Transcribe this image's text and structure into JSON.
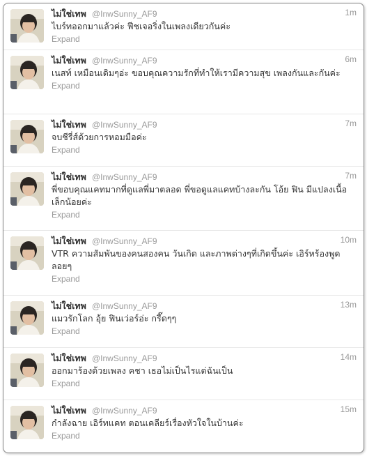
{
  "tweets": [
    {
      "name": "ไม่ใช่เทพ",
      "handle": "@InwSunny_AF9",
      "time": "1m",
      "text": "ไบร์ทออกมาแล้วค่ะ ฟีชเจอริ่งในเพลงเดียวกันค่ะ",
      "expand": "Expand"
    },
    {
      "name": "ไม่ใช่เทพ",
      "handle": "@InwSunny_AF9",
      "time": "6m",
      "text": "เนสท์ เหมือนเดิมๆอ่ะ ขอบคุณความรักที่ทำให้เรามีความสุข เพลงกันและกันค่ะ",
      "expand": "Expand"
    },
    {
      "name": "ไม่ใช่เทพ",
      "handle": "@InwSunny_AF9",
      "time": "7m",
      "text": "จบชีรี่ส์ด้วยการหอมมือค่ะ",
      "expand": "Expand"
    },
    {
      "name": "ไม่ใช่เทพ",
      "handle": "@InwSunny_AF9",
      "time": "7m",
      "text": "พี่ขอบคุณแคทมากที่ดูแลพี่มาตลอด พี่ขอดูแลแคทบ้างละกัน โอ้ย ฟิน มีแปลงเนื้อเล็กน้อยค่ะ",
      "expand": "Expand"
    },
    {
      "name": "ไม่ใช่เทพ",
      "handle": "@InwSunny_AF9",
      "time": "10m",
      "text": "VTR ความสัมพันของคนสองคน วันเกิด และภาพต่างๆที่เกิดขึ้นค่ะ เอิร์หร้องพูดลอยๆ",
      "expand": "Expand"
    },
    {
      "name": "ไม่ใช่เทพ",
      "handle": "@InwSunny_AF9",
      "time": "13m",
      "text": "แมวรักโลก อุ้ย ฟินเว่อร์อ่ะ กรี๊ดๆๆ",
      "expand": "Expand"
    },
    {
      "name": "ไม่ใช่เทพ",
      "handle": "@InwSunny_AF9",
      "time": "14m",
      "text": "ออกมาร้องด้วยเพลง คชา เธอไม่เป็นไรแต่ฉันเป็น",
      "expand": "Expand"
    },
    {
      "name": "ไม่ใช่เทพ",
      "handle": "@InwSunny_AF9",
      "time": "15m",
      "text": "กำลังฉาย เอิร์ทแคท ตอนเคลียร์เรื่องหัวใจในบ้านค่ะ",
      "expand": "Expand"
    }
  ]
}
